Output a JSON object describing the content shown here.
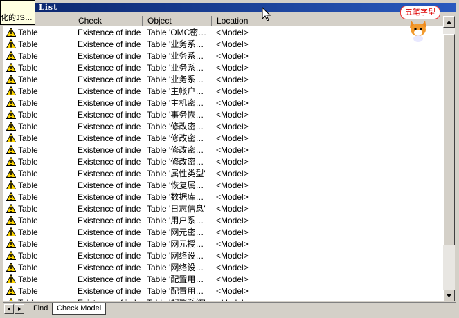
{
  "window": {
    "title": "List"
  },
  "tooltip": {
    "text": "化的JS…"
  },
  "ime_status": {
    "label": "五笔字型"
  },
  "columns": [
    "",
    "Check",
    "Object",
    "Location"
  ],
  "rows": [
    {
      "category": "Table",
      "check": "Existence of index",
      "object": "Table 'OMC密…",
      "location": "<Model>"
    },
    {
      "category": "Table",
      "check": "Existence of index",
      "object": "Table '业务系…",
      "location": "<Model>"
    },
    {
      "category": "Table",
      "check": "Existence of index",
      "object": "Table '业务系…",
      "location": "<Model>"
    },
    {
      "category": "Table",
      "check": "Existence of index",
      "object": "Table '业务系…",
      "location": "<Model>"
    },
    {
      "category": "Table",
      "check": "Existence of index",
      "object": "Table '业务系…",
      "location": "<Model>"
    },
    {
      "category": "Table",
      "check": "Existence of index",
      "object": "Table '主帐户…",
      "location": "<Model>"
    },
    {
      "category": "Table",
      "check": "Existence of index",
      "object": "Table '主机密…",
      "location": "<Model>"
    },
    {
      "category": "Table",
      "check": "Existence of index",
      "object": "Table '事务恢…",
      "location": "<Model>"
    },
    {
      "category": "Table",
      "check": "Existence of index",
      "object": "Table '修改密…",
      "location": "<Model>"
    },
    {
      "category": "Table",
      "check": "Existence of index",
      "object": "Table '修改密…",
      "location": "<Model>"
    },
    {
      "category": "Table",
      "check": "Existence of index",
      "object": "Table '修改密…",
      "location": "<Model>"
    },
    {
      "category": "Table",
      "check": "Existence of index",
      "object": "Table '修改密…",
      "location": "<Model>"
    },
    {
      "category": "Table",
      "check": "Existence of index",
      "object": "Table '属性类型'",
      "location": "<Model>"
    },
    {
      "category": "Table",
      "check": "Existence of index",
      "object": "Table '恢复属…",
      "location": "<Model>"
    },
    {
      "category": "Table",
      "check": "Existence of index",
      "object": "Table '数据库…",
      "location": "<Model>"
    },
    {
      "category": "Table",
      "check": "Existence of index",
      "object": "Table '日志信息'",
      "location": "<Model>"
    },
    {
      "category": "Table",
      "check": "Existence of index",
      "object": "Table '用户系…",
      "location": "<Model>"
    },
    {
      "category": "Table",
      "check": "Existence of index",
      "object": "Table '网元密…",
      "location": "<Model>"
    },
    {
      "category": "Table",
      "check": "Existence of index",
      "object": "Table '网元授…",
      "location": "<Model>"
    },
    {
      "category": "Table",
      "check": "Existence of index",
      "object": "Table '网络设…",
      "location": "<Model>"
    },
    {
      "category": "Table",
      "check": "Existence of index",
      "object": "Table '网络设…",
      "location": "<Model>"
    },
    {
      "category": "Table",
      "check": "Existence of index",
      "object": "Table '配置用…",
      "location": "<Model>"
    },
    {
      "category": "Table",
      "check": "Existence of index",
      "object": "Table '配置用…",
      "location": "<Model>"
    },
    {
      "category": "Table",
      "check": "Existence of index",
      "object": "Table '配置系统'",
      "location": "<Model>"
    }
  ],
  "tabs": [
    {
      "label": "Find",
      "active": false
    },
    {
      "label": "Check Model",
      "active": true
    }
  ],
  "icons": {
    "row_icon": "warning-icon",
    "colors": {
      "warning_fill": "#ffd700",
      "title_bar": "#0a246a"
    }
  }
}
